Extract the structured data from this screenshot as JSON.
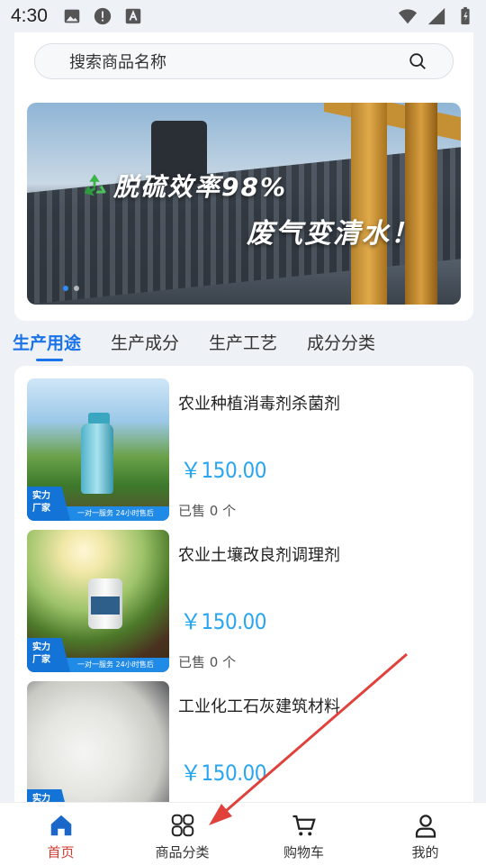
{
  "status_bar": {
    "time": "4:30"
  },
  "search": {
    "placeholder": "搜索商品名称"
  },
  "banner": {
    "headline": "脱硫效率98%",
    "subline": "废气变清水！",
    "dots": 2,
    "active_dot": 0
  },
  "tabs": [
    {
      "label": "生产用途",
      "active": true
    },
    {
      "label": "生产成分",
      "active": false
    },
    {
      "label": "生产工艺",
      "active": false
    },
    {
      "label": "成分分类",
      "active": false
    }
  ],
  "products": [
    {
      "name": "农业种植消毒剂杀菌剂",
      "price": "￥150.00",
      "sold": "已售 0 个",
      "badge": "实力\n厂家",
      "strip": "一对一服务 24小时售后"
    },
    {
      "name": "农业土壤改良剂调理剂",
      "price": "￥150.00",
      "sold": "已售 0 个",
      "badge": "实力\n厂家",
      "strip": "一对一服务 24小时售后"
    },
    {
      "name": "工业化工石灰建筑材料",
      "price": "￥150.00",
      "sold": "",
      "badge": "实力",
      "strip": ""
    }
  ],
  "bottom_nav": [
    {
      "label": "首页",
      "icon": "home-icon",
      "active": true
    },
    {
      "label": "商品分类",
      "icon": "category-icon",
      "active": false
    },
    {
      "label": "购物车",
      "icon": "cart-icon",
      "active": false
    },
    {
      "label": "我的",
      "icon": "user-icon",
      "active": false
    }
  ],
  "colors": {
    "accent": "#1a73e8",
    "price": "#2aa5f0",
    "nav_active": "#d03a2f",
    "annotation": "#e0413b"
  }
}
